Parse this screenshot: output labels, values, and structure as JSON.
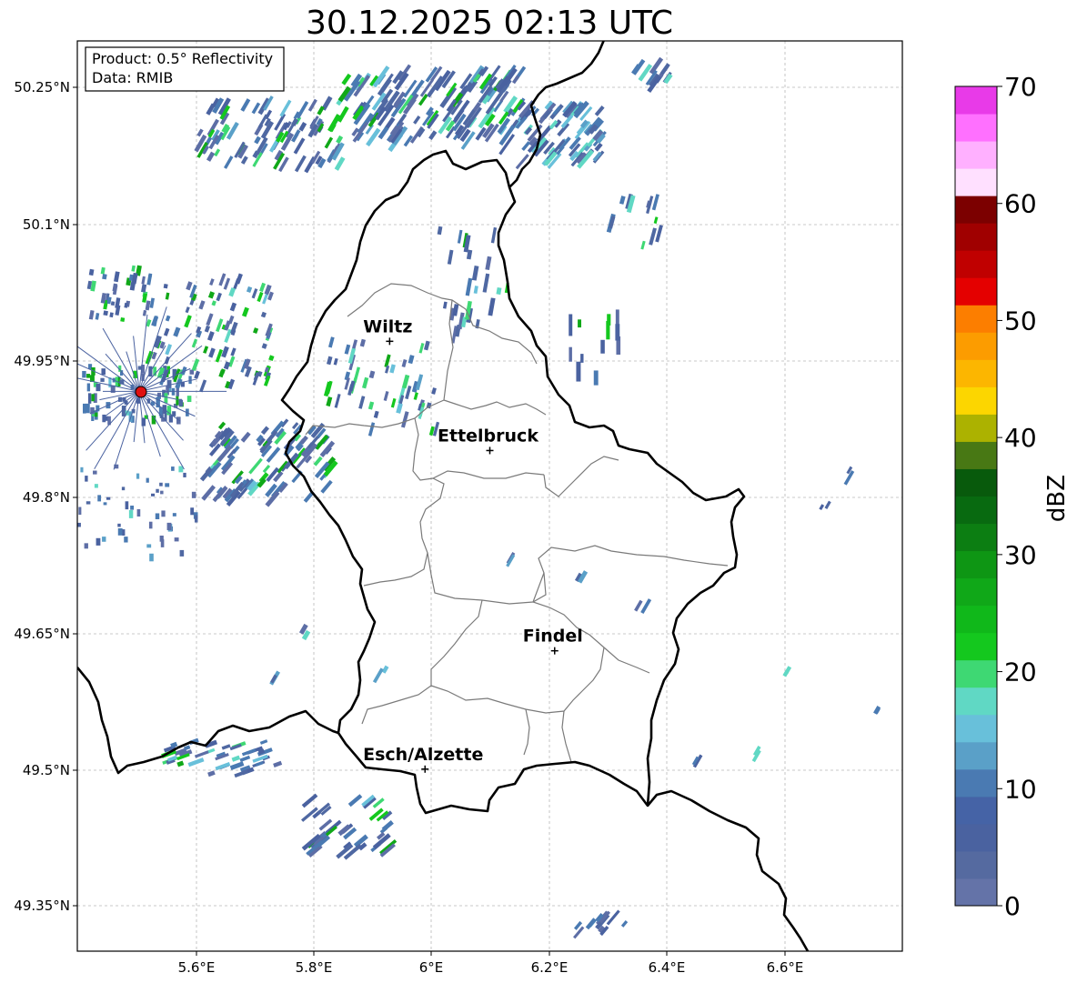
{
  "title": "30.12.2025 02:13 UTC",
  "info_box": {
    "product": "Product: 0.5° Reflectivity",
    "data": "Data: RMIB"
  },
  "lat_ticks": [
    "50.25°N",
    "50.1°N",
    "49.95°N",
    "49.8°N",
    "49.65°N",
    "49.5°N",
    "49.35°N"
  ],
  "lon_ticks": [
    "5.6°E",
    "5.8°E",
    "6°E",
    "6.2°E",
    "6.4°E",
    "6.6°E"
  ],
  "cities": [
    {
      "name": "Wiltz",
      "lon": 5.93,
      "lat": 49.97
    },
    {
      "name": "Ettelbruck",
      "lon": 6.1,
      "lat": 49.85
    },
    {
      "name": "Findel",
      "lon": 6.21,
      "lat": 49.63
    },
    {
      "name": "Esch/Alzette",
      "lon": 5.99,
      "lat": 49.5
    }
  ],
  "radar_site": {
    "lon": 5.505,
    "lat": 49.915
  },
  "colorbar": {
    "label": "dBZ",
    "ticks": [
      "0",
      "10",
      "20",
      "30",
      "40",
      "50",
      "60",
      "70"
    ],
    "min": 0,
    "max": 70,
    "colors": [
      "#6473a8",
      "#556aa0",
      "#4a62a0",
      "#4563a6",
      "#4a7ab2",
      "#5aa0c8",
      "#68c0da",
      "#60d8c4",
      "#3ed873",
      "#14c81e",
      "#10b81a",
      "#10a818",
      "#0e9614",
      "#0c7e12",
      "#086a10",
      "#085a0c",
      "#487814",
      "#acb200",
      "#fcd600",
      "#fcb600",
      "#fc9c00",
      "#fc7e00",
      "#e40000",
      "#c00000",
      "#a00000",
      "#7c0000",
      "#ffe0ff",
      "#ffb0ff",
      "#ff70ff",
      "#e83ae8"
    ]
  },
  "map_extent": {
    "lon_min": 5.4,
    "lon_max": 6.8,
    "lat_min": 49.3,
    "lat_max": 50.3
  }
}
